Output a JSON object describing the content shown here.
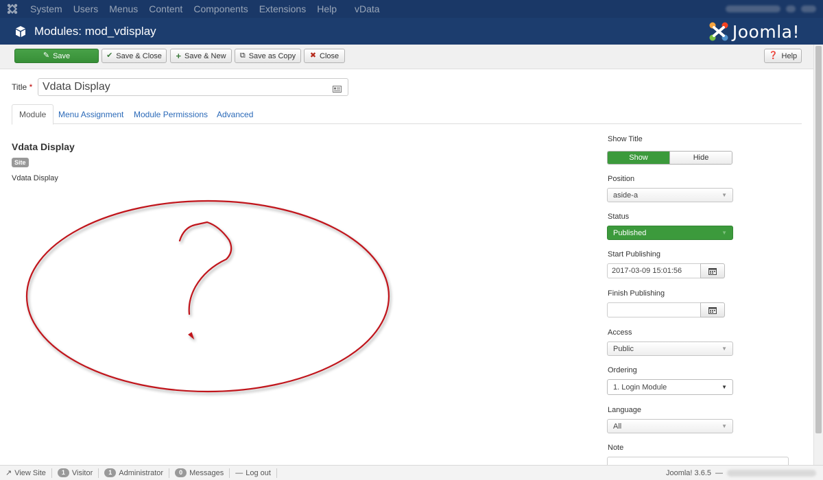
{
  "topnav": {
    "items": [
      "System",
      "Users",
      "Menus",
      "Content",
      "Components",
      "Extensions",
      "Help",
      "vData"
    ]
  },
  "header": {
    "title": "Modules: mod_vdisplay",
    "brand": "Joomla!"
  },
  "toolbar": {
    "save": "Save",
    "save_close": "Save & Close",
    "save_new": "Save & New",
    "save_copy": "Save as Copy",
    "close": "Close",
    "help": "Help"
  },
  "form": {
    "title_label": "Title",
    "required_mark": "*",
    "title_value": "Vdata Display"
  },
  "tabs": [
    "Module",
    "Menu Assignment",
    "Module Permissions",
    "Advanced"
  ],
  "module": {
    "heading": "Vdata Display",
    "badge": "Site",
    "description": "Vdata Display"
  },
  "options": {
    "show_title_label": "Show Title",
    "show_option": "Show",
    "hide_option": "Hide",
    "position_label": "Position",
    "position_value": "aside-a",
    "status_label": "Status",
    "status_value": "Published",
    "start_label": "Start Publishing",
    "start_value": "2017-03-09 15:01:56",
    "finish_label": "Finish Publishing",
    "finish_value": "",
    "access_label": "Access",
    "access_value": "Public",
    "ordering_label": "Ordering",
    "ordering_value": "1. Login Module",
    "language_label": "Language",
    "language_value": "All",
    "note_label": "Note"
  },
  "statusbar": {
    "view_site": "View Site",
    "visitor_count": "1",
    "visitor_label": "Visitor",
    "admin_count": "1",
    "admin_label": "Administrator",
    "messages_count": "0",
    "messages_label": "Messages",
    "logout": "Log out",
    "version": "Joomla! 3.6.5",
    "separator": "—"
  },
  "colors": {
    "nav_bg": "#1a3867",
    "header_bg": "#1c3d6e",
    "success": "#3c9a3c",
    "link": "#2a69b8",
    "annotation": "#c0121a"
  }
}
